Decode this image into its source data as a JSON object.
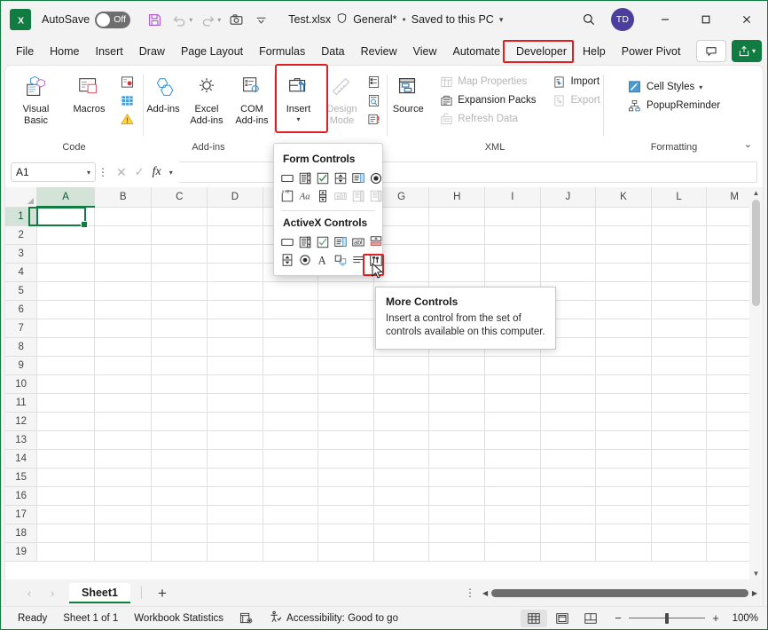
{
  "titlebar": {
    "logo_text": "X",
    "autosave_label": "AutoSave",
    "autosave_state": "Off",
    "file_name": "Test.xlsx",
    "sensitivity": "General*",
    "separator": "•",
    "save_state": "Saved to this PC",
    "avatar_initials": "TD",
    "minimize": "–",
    "maximize": "☐",
    "close": "✕"
  },
  "tabs": [
    {
      "label": "File"
    },
    {
      "label": "Home"
    },
    {
      "label": "Insert"
    },
    {
      "label": "Draw"
    },
    {
      "label": "Page Layout"
    },
    {
      "label": "Formulas"
    },
    {
      "label": "Data"
    },
    {
      "label": "Review"
    },
    {
      "label": "View"
    },
    {
      "label": "Automate"
    },
    {
      "label": "Developer"
    },
    {
      "label": "Help"
    },
    {
      "label": "Power Pivot"
    }
  ],
  "active_tab": "Developer",
  "ribbon": {
    "groups": [
      {
        "name": "Code",
        "label": "Code",
        "big_buttons": [
          {
            "label": "Visual Basic",
            "icon": "visual-basic-icon"
          },
          {
            "label": "Macros",
            "icon": "macros-icon"
          }
        ],
        "small_buttons": [
          {
            "label": "",
            "icon": "record-macro-icon"
          },
          {
            "label": "",
            "icon": "use-relative-references-icon"
          },
          {
            "label": "",
            "icon": "macro-security-icon"
          }
        ]
      },
      {
        "name": "Add-ins",
        "label": "Add-ins",
        "big_buttons": [
          {
            "label": "Add-ins",
            "icon": "add-ins-icon"
          },
          {
            "label": "Excel Add-ins",
            "icon": "excel-add-ins-icon"
          },
          {
            "label": "COM Add-ins",
            "icon": "com-add-ins-icon"
          }
        ]
      },
      {
        "name": "Controls",
        "label": "",
        "big_buttons": [
          {
            "label": "Insert",
            "icon": "insert-controls-icon",
            "has_caret": true,
            "highlighted": true
          },
          {
            "label": "Design Mode",
            "icon": "design-mode-icon",
            "disabled": true
          }
        ],
        "small_buttons": [
          {
            "label": "",
            "icon": "properties-icon"
          },
          {
            "label": "",
            "icon": "view-code-icon"
          },
          {
            "label": "",
            "icon": "run-dialog-icon"
          }
        ]
      },
      {
        "name": "XML",
        "label": "XML",
        "big_buttons": [
          {
            "label": "Source",
            "icon": "xml-source-icon"
          }
        ],
        "small_buttons": [
          {
            "label": "Map Properties",
            "icon": "map-properties-icon",
            "disabled": true
          },
          {
            "label": "Expansion Packs",
            "icon": "expansion-packs-icon",
            "disabled": false
          },
          {
            "label": "Refresh Data",
            "icon": "refresh-data-icon",
            "disabled": true
          },
          {
            "label": "Import",
            "icon": "import-icon",
            "disabled": false
          },
          {
            "label": "Export",
            "icon": "export-icon",
            "disabled": true
          }
        ]
      },
      {
        "name": "Formatting",
        "label": "Formatting",
        "small_buttons": [
          {
            "label": "Cell Styles",
            "icon": "cell-styles-icon",
            "has_caret": true
          },
          {
            "label": "PopupReminder",
            "icon": "popup-reminder-icon"
          }
        ]
      }
    ],
    "collapse_caret": "⌄"
  },
  "formula_bar": {
    "name_box_value": "A1",
    "cancel_icon": "✕",
    "enter_icon": "✓",
    "fx_label": "fx",
    "formula_value": "",
    "formula_placeholder": ""
  },
  "gallery": {
    "form_controls_title": "Form Controls",
    "activex_controls_title": "ActiveX Controls",
    "form_controls": [
      "button-icon",
      "combo-box-icon",
      "check-box-icon",
      "spin-button-icon",
      "list-box-icon",
      "option-button-icon",
      "group-box-icon",
      "label-icon",
      "scroll-bar-icon",
      "text-field-icon",
      "combo-list-edit-icon",
      "combo-drop-down-icon"
    ],
    "activex_controls": [
      "command-button-icon",
      "combo-box-icon",
      "check-box-icon",
      "list-box-icon",
      "text-box-icon",
      "scroll-bar-icon",
      "spin-button-icon",
      "option-button-icon",
      "label-icon",
      "image-icon",
      "toggle-button-icon",
      "more-controls-icon"
    ],
    "highlighted_control": "more-controls-icon"
  },
  "tooltip": {
    "title": "More Controls",
    "body": "Insert a control from the set of controls available on this computer."
  },
  "grid": {
    "columns": [
      "A",
      "B",
      "C",
      "D",
      "E",
      "F",
      "G",
      "H",
      "I",
      "J",
      "K",
      "L",
      "M"
    ],
    "rows": [
      "1",
      "2",
      "3",
      "4",
      "5",
      "6",
      "7",
      "8",
      "9",
      "10",
      "11",
      "12",
      "13",
      "14",
      "15",
      "16",
      "17",
      "18",
      "19"
    ],
    "selected_cell": "A1"
  },
  "sheetbar": {
    "prev_arrow": "‹",
    "next_arrow": "›",
    "sheets": [
      "Sheet1"
    ],
    "active_sheet": "Sheet1",
    "add_sheet": "+"
  },
  "statusbar": {
    "mode": "Ready",
    "sheet_count": "Sheet 1 of 1",
    "workbook_statistics": "Workbook Statistics",
    "accessibility": "Accessibility: Good to go",
    "views": [
      "normal-view-icon",
      "page-layout-view-icon",
      "page-break-view-icon"
    ],
    "active_view": "normal-view-icon",
    "zoom_minus": "−",
    "zoom_plus": "+",
    "zoom_level": "100%"
  },
  "colors": {
    "excel_green": "#107c41",
    "highlight_red": "#e02020",
    "avatar_purple": "#4b3f9e"
  }
}
